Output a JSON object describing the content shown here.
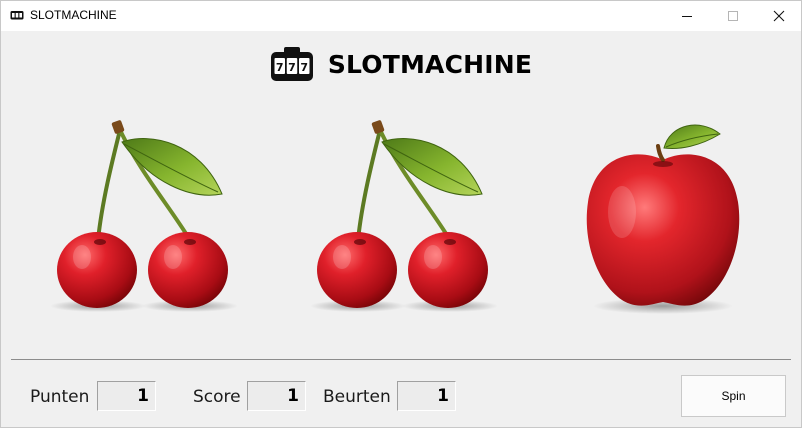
{
  "window": {
    "title": "SLOTMACHINE",
    "controls": [
      "minimize",
      "maximize",
      "close"
    ]
  },
  "header": {
    "icon": "slot-machine-777-icon",
    "icon_text": "777",
    "title": "SLOTMACHINE"
  },
  "reels": [
    {
      "symbol": "cherries",
      "icon": "cherries-icon"
    },
    {
      "symbol": "cherries",
      "icon": "cherries-icon"
    },
    {
      "symbol": "apple",
      "icon": "apple-icon"
    }
  ],
  "stats": {
    "punten_label": "Punten",
    "punten_value": "1",
    "score_label": "Score",
    "score_value": "1",
    "beurten_label": "Beurten",
    "beurten_value": "1"
  },
  "spin_label": "Spin",
  "colors": {
    "background": "#f0f0f0",
    "fruit_red": "#c81a22",
    "leaf_green": "#6b9a22"
  }
}
